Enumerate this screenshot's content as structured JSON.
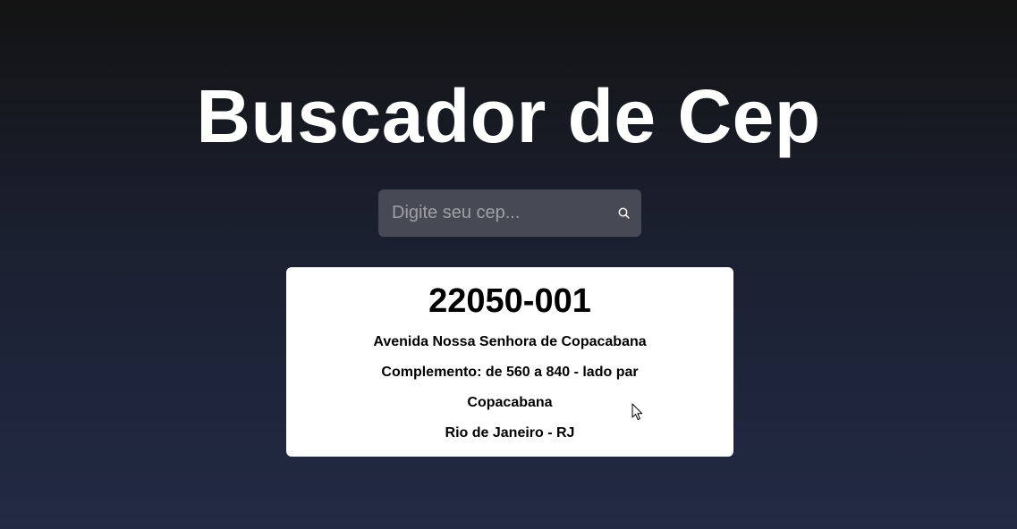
{
  "header": {
    "title": "Buscador de Cep"
  },
  "search": {
    "placeholder": "Digite seu cep...",
    "value": "",
    "button_icon": "search-icon"
  },
  "result": {
    "cep": "22050-001",
    "logradouro": "Avenida Nossa Senhora de Copacabana",
    "complemento": "Complemento: de 560 a 840 - lado par",
    "bairro": "Copacabana",
    "cidade_uf": "Rio de Janeiro - RJ"
  },
  "colors": {
    "background_top": "#131313",
    "background_bottom": "#222a44",
    "search_bg": "#474a54",
    "card_bg": "#ffffff"
  }
}
